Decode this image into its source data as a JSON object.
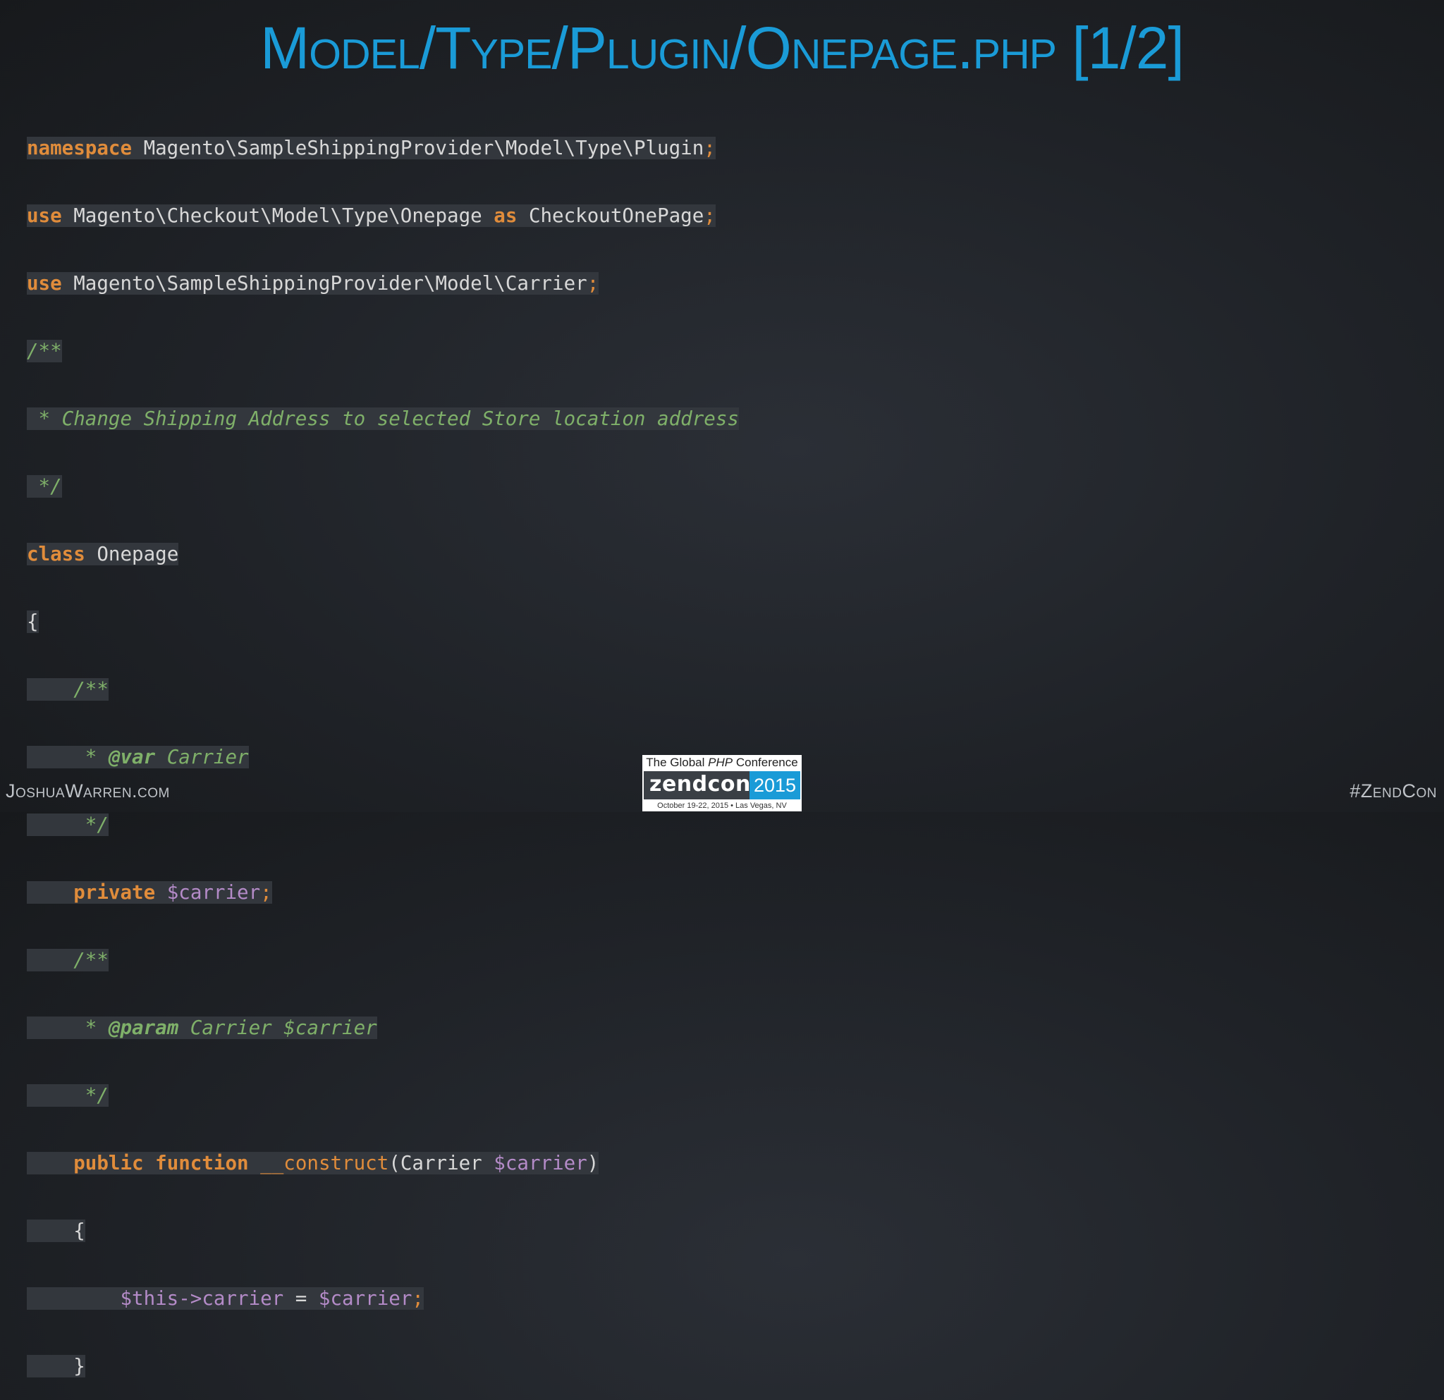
{
  "title": "Model/Type/Plugin/Onepage.php [1/2]",
  "code": {
    "l1_kw": "namespace",
    "l1_ns": " Magento\\SampleShippingProvider\\Model\\Type\\Plugin",
    "l1_end": ";",
    "l2_kw": "use",
    "l2_ns": " Magento\\Checkout\\Model\\Type\\Onepage ",
    "l2_as": "as",
    "l2_alias": " CheckoutOnePage",
    "l2_end": ";",
    "l3_kw": "use",
    "l3_ns": " Magento\\SampleShippingProvider\\Model\\Carrier",
    "l3_end": ";",
    "l4": "/**",
    "l5": " * Change Shipping Address to selected Store location address",
    "l6": " */",
    "l7_kw": "class",
    "l7_name": " Onepage",
    "l8": "{",
    "l9": "    /**",
    "l10_pre": "     * ",
    "l10_tag": "@var",
    "l10_rest": " Carrier",
    "l11": "     */",
    "l12_indent": "    ",
    "l12_kw": "private",
    "l12_sp": " ",
    "l12_var": "$carrier",
    "l12_end": ";",
    "l13": "    /**",
    "l14_pre": "     * ",
    "l14_tag": "@param",
    "l14_rest": " Carrier $carrier",
    "l15": "     */",
    "l16_indent": "    ",
    "l16_kw1": "public",
    "l16_sp": " ",
    "l16_kw2": "function",
    "l16_sp2": " ",
    "l16_fn": "__construct",
    "l16_open": "(Carrier ",
    "l16_var": "$carrier",
    "l16_close": ")",
    "l17": "    {",
    "l18_indent": "        ",
    "l18_this": "$this->carrier",
    "l18_eq": " = ",
    "l18_var": "$carrier",
    "l18_end": ";",
    "l19": "    }"
  },
  "footer": {
    "left": "JoshuaWarren.com",
    "right": "#ZendCon"
  },
  "logo": {
    "tagline_pre": "The Global ",
    "tagline_php": "PHP",
    "tagline_post": " Conference",
    "word": "zendcon",
    "year": "2015",
    "date": "October 19-22, 2015 • Las Vegas, NV"
  },
  "colors": {
    "title": "#1a9bd7",
    "keyword": "#e08c3b",
    "comment": "#7fb069",
    "variable": "#b48bc8",
    "code_text": "#d8d8d8",
    "highlight_bg": "#33373d"
  }
}
